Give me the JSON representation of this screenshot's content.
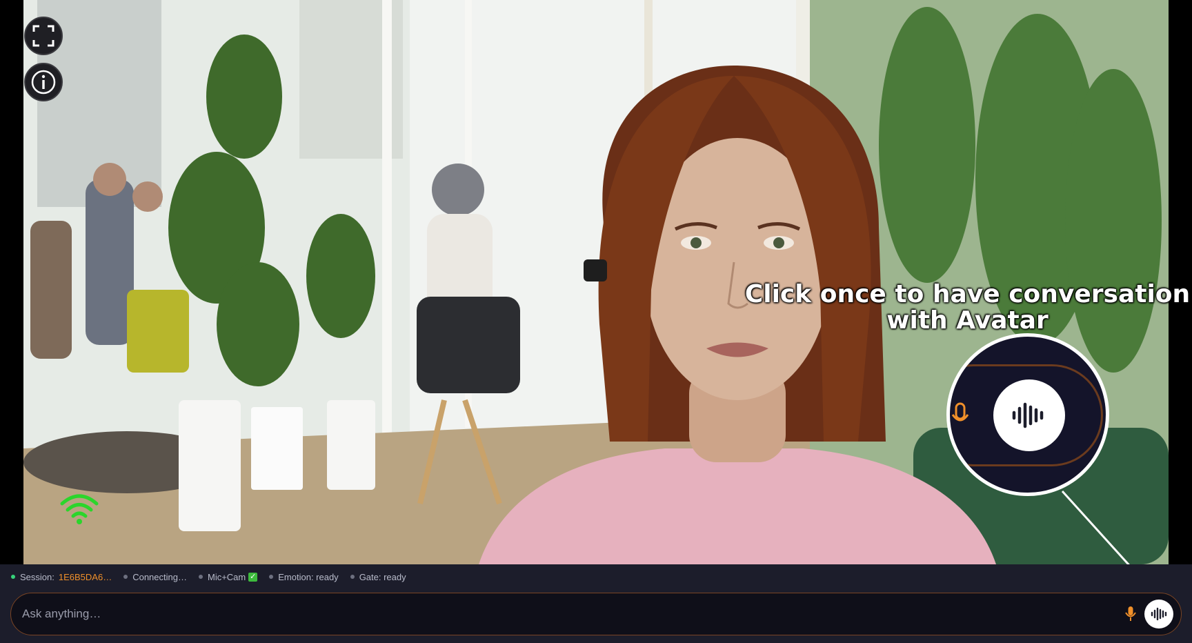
{
  "overlay": {
    "fullscreen_icon": "fullscreen-icon",
    "info_icon": "info-icon",
    "wifi_icon": "wifi-icon",
    "wifi_color": "#2bd62b"
  },
  "callout": {
    "line1": "Click once to have conversation",
    "line2": "with Avatar"
  },
  "status": {
    "session_label": "Session:",
    "session_id": "1E6B5DA6…",
    "connection": "Connecting…",
    "media": "Mic+Cam",
    "media_ok": "✓",
    "emotion": "Emotion: ready",
    "gate": "Gate: ready"
  },
  "input": {
    "placeholder": "Ask anything…",
    "value": ""
  },
  "colors": {
    "accent_orange": "#f0902a",
    "bar_bg": "#1c1d2b",
    "status_green": "#36d27a"
  }
}
